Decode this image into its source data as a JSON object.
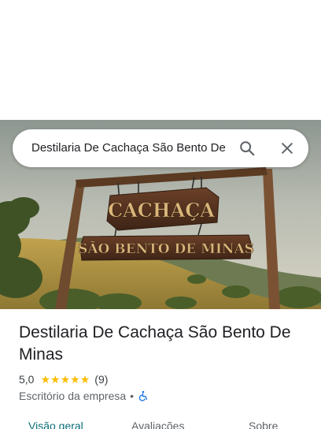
{
  "search": {
    "query": "Destilaria De Cachaça São Bento De"
  },
  "icons": {
    "search": "search-icon",
    "close": "close-icon",
    "star": "star-icon",
    "accessibility": "wheelchair-accessible-icon"
  },
  "hero_sign": {
    "top_text": "CACHAÇA",
    "bottom_text": "SÃO BENTO DE MINAS"
  },
  "place": {
    "name": "Destilaria De Cachaça São Bento De Minas",
    "rating": "5,0",
    "stars": 5,
    "review_count": "(9)",
    "category": "Escritório da empresa",
    "separator": "•"
  },
  "tabs": [
    {
      "label": "Visão geral",
      "active": true
    },
    {
      "label": "Avaliações",
      "active": false
    },
    {
      "label": "Sobre",
      "active": false
    }
  ],
  "colors": {
    "star": "#fbbc04",
    "active_tab": "#0b6e7a",
    "accessibility": "#1a73e8"
  }
}
